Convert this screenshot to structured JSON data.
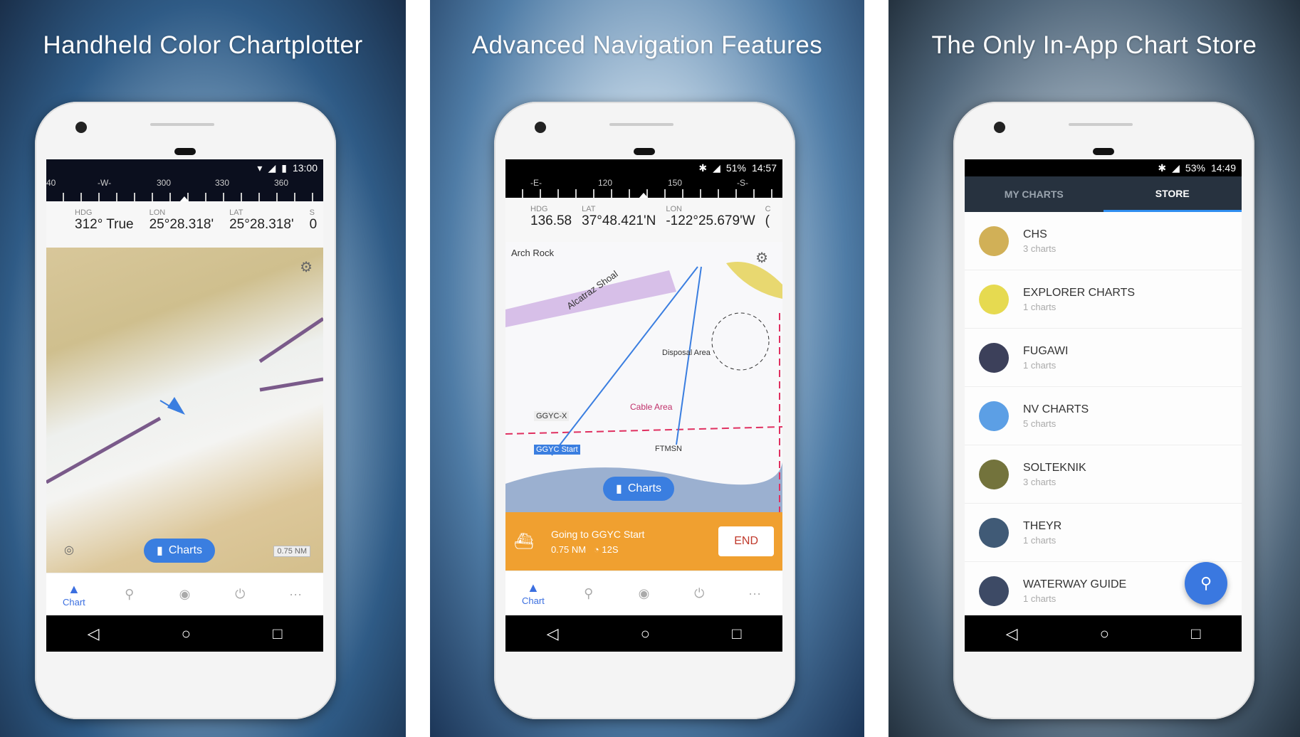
{
  "panels": [
    {
      "title": "Handheld Color Chartplotter",
      "status": {
        "time": "13:00"
      },
      "compass": [
        "40",
        "-W-",
        "300",
        "330",
        "360"
      ],
      "data": [
        {
          "label": "HDG",
          "value": "312° True"
        },
        {
          "label": "LON",
          "value": "25°28.318'"
        },
        {
          "label": "LAT",
          "value": "25°28.318'"
        },
        {
          "label": "S",
          "value": "0"
        }
      ],
      "map": {
        "charts_button": "Charts",
        "scale": "0.75 NM"
      },
      "nav": [
        {
          "label": "Chart",
          "icon": "navigation-arrow-icon"
        },
        {
          "icon": "marker-icon"
        },
        {
          "icon": "route-icon"
        },
        {
          "icon": "track-icon"
        },
        {
          "icon": "more-icon"
        }
      ]
    },
    {
      "title": "Advanced Navigation Features",
      "status": {
        "battery": "51%",
        "time": "14:57"
      },
      "compass": [
        "-E-",
        "120",
        "150",
        "-S-"
      ],
      "data": [
        {
          "label": "HDG",
          "value": "136.58"
        },
        {
          "label": "LAT",
          "value": "37°48.421'N"
        },
        {
          "label": "LON",
          "value": "-122°25.679'W"
        },
        {
          "label": "C",
          "value": "("
        }
      ],
      "map": {
        "charts_button": "Charts",
        "labels": [
          "Arch Rock",
          "Alcatraz Shoal",
          "GGYC-X",
          "GGYC Start",
          "FTMSN",
          "Cable Area",
          "Disposal Area"
        ]
      },
      "navigation": {
        "going_to": "Going to GGYC Start",
        "distance": "0.75 NM",
        "time": "12S",
        "end_label": "END"
      },
      "nav": [
        {
          "label": "Chart",
          "icon": "navigation-arrow-icon"
        },
        {
          "icon": "marker-icon"
        },
        {
          "icon": "route-icon"
        },
        {
          "icon": "track-icon"
        },
        {
          "icon": "more-icon"
        }
      ]
    },
    {
      "title": "The Only In-App Chart Store",
      "status": {
        "battery": "53%",
        "time": "14:49"
      },
      "tabs": [
        {
          "label": "MY CHARTS",
          "active": false
        },
        {
          "label": "STORE",
          "active": true
        }
      ],
      "store": [
        {
          "name": "CHS",
          "count": "3 charts",
          "color": "#c9a23a"
        },
        {
          "name": "EXPLORER CHARTS",
          "count": "1 charts",
          "color": "#e2d431"
        },
        {
          "name": "FUGAWI",
          "count": "1 charts",
          "color": "#1a1f3d"
        },
        {
          "name": "NV CHARTS",
          "count": "5 charts",
          "color": "#3f8ee0"
        },
        {
          "name": "SOLTEKNIK",
          "count": "3 charts",
          "color": "#5a5a1a"
        },
        {
          "name": "THEYR",
          "count": "1 charts",
          "color": "#1f3d5e"
        },
        {
          "name": "WATERWAY GUIDE",
          "count": "1 charts",
          "color": "#1b2a4a"
        }
      ]
    }
  ],
  "colors": {
    "accent": "#3a7ee0",
    "nav_bar": "#f0a030",
    "store_header": "#27323f"
  }
}
